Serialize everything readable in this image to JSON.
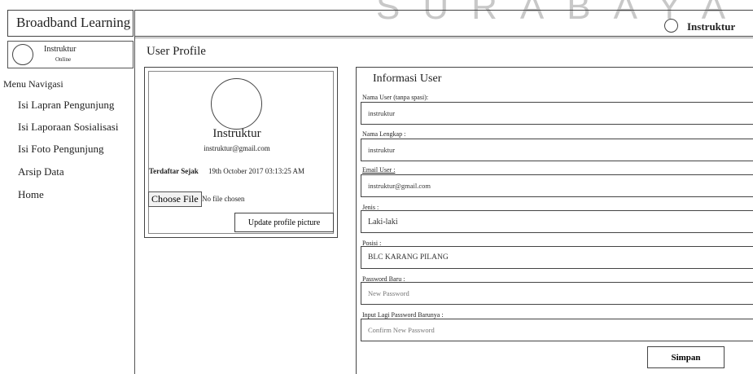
{
  "watermark": "SURABAYA",
  "sidebar": {
    "brand": "Broadband Learning",
    "user": {
      "name": "Instruktur",
      "status": "Online"
    },
    "nav_title": "Menu Navigasi",
    "items": [
      {
        "label": "Isi Lapran Pengunjung"
      },
      {
        "label": "Isi Laporaan Sosialisasi"
      },
      {
        "label": "Isi Foto Pengunjung"
      },
      {
        "label": "Arsip Data"
      },
      {
        "label": "Home"
      }
    ]
  },
  "header": {
    "user_name": "Instruktur"
  },
  "main": {
    "page_title": "User Profile",
    "profile": {
      "name": "Instruktur",
      "email": "instruktur@gmail.com",
      "since_label": "Terdaftar Sejak",
      "since_value": "19th October 2017 03:13:25 AM",
      "choose_file_label": "Choose File",
      "file_status": "No file chosen",
      "update_label": "Update profile picture"
    },
    "form": {
      "title": "Informasi User",
      "fields": [
        {
          "label": "Nama User (tanpa spasi):",
          "value": "instruktur",
          "placeholder": ""
        },
        {
          "label": "Nama Lengkap :",
          "value": "instruktur",
          "placeholder": ""
        },
        {
          "label": "Email User :",
          "value": "instruktur@gmail.com",
          "placeholder": ""
        },
        {
          "label": "Jenis :",
          "value": "Laki-laki",
          "placeholder": ""
        },
        {
          "label": "Posisi :",
          "value": "BLC KARANG PILANG",
          "placeholder": ""
        },
        {
          "label": "Password Baru :",
          "value": "",
          "placeholder": "New Password"
        },
        {
          "label": "Input Lagi Password Barunya :",
          "value": "",
          "placeholder": "Confirm New Password"
        }
      ],
      "save_label": "Simpan"
    }
  }
}
